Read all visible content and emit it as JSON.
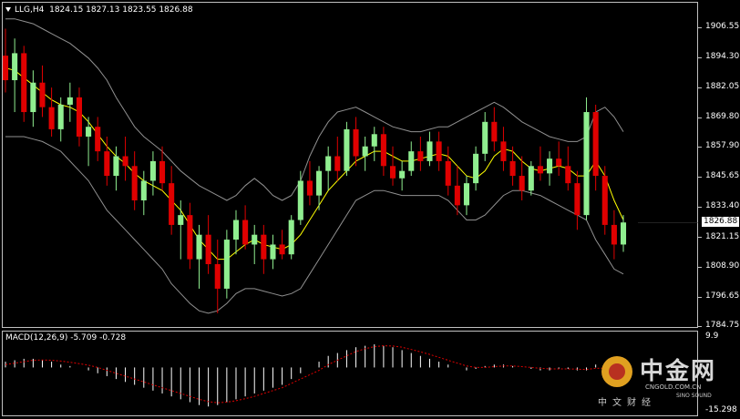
{
  "header": {
    "symbol": "LLG,H4",
    "ohlc": "1824.15 1827.13 1823.55 1826.88"
  },
  "price_axis": {
    "labels": [
      "1906.55",
      "1894.30",
      "1882.05",
      "1869.80",
      "1857.90",
      "1845.65",
      "1833.40",
      "1821.15",
      "1808.90",
      "1796.65",
      "1784.75"
    ],
    "current_price": "1826.88"
  },
  "macd": {
    "label": "MACD(12,26,9) -5.709 -0.728",
    "axis_top": "9.9",
    "axis_bottom": "-15.298"
  },
  "watermark": {
    "brand": "中金网",
    "site": "CNGOLD.COM.CN",
    "slogan": "中文财经",
    "sinosound": "SINO SOUND"
  },
  "colors": {
    "background": "#000000",
    "bull_candle": "#90ee90",
    "bear_candle": "#e00000",
    "ma_line": "#ffff00",
    "band_line": "#909090",
    "signal_line": "#e00000",
    "histogram": "#ffffff"
  },
  "chart_data": [
    {
      "type": "candlestick",
      "title": "LLG,H4",
      "ylim": [
        1784.75,
        1912
      ],
      "grid": false,
      "ohlc": [
        [
          1895,
          1906,
          1880,
          1885
        ],
        [
          1885,
          1902,
          1872,
          1896
        ],
        [
          1896,
          1899,
          1868,
          1872
        ],
        [
          1872,
          1889,
          1866,
          1884
        ],
        [
          1884,
          1891,
          1870,
          1874
        ],
        [
          1874,
          1882,
          1862,
          1865
        ],
        [
          1865,
          1878,
          1860,
          1875
        ],
        [
          1875,
          1884,
          1868,
          1878
        ],
        [
          1878,
          1882,
          1858,
          1862
        ],
        [
          1862,
          1870,
          1850,
          1866
        ],
        [
          1866,
          1870,
          1852,
          1856
        ],
        [
          1856,
          1862,
          1842,
          1846
        ],
        [
          1846,
          1858,
          1840,
          1854
        ],
        [
          1854,
          1862,
          1844,
          1850
        ],
        [
          1850,
          1856,
          1832,
          1836
        ],
        [
          1836,
          1848,
          1830,
          1844
        ],
        [
          1844,
          1856,
          1838,
          1852
        ],
        [
          1852,
          1858,
          1840,
          1843
        ],
        [
          1843,
          1850,
          1822,
          1826
        ],
        [
          1826,
          1836,
          1812,
          1830
        ],
        [
          1830,
          1835,
          1808,
          1812
        ],
        [
          1812,
          1826,
          1800,
          1822
        ],
        [
          1822,
          1830,
          1806,
          1810
        ],
        [
          1810,
          1820,
          1790,
          1800
        ],
        [
          1800,
          1824,
          1796,
          1820
        ],
        [
          1820,
          1832,
          1814,
          1828
        ],
        [
          1828,
          1834,
          1816,
          1818
        ],
        [
          1818,
          1826,
          1810,
          1822
        ],
        [
          1822,
          1826,
          1806,
          1812
        ],
        [
          1812,
          1822,
          1808,
          1818
        ],
        [
          1818,
          1824,
          1812,
          1814
        ],
        [
          1814,
          1830,
          1812,
          1828
        ],
        [
          1828,
          1848,
          1826,
          1844
        ],
        [
          1844,
          1852,
          1834,
          1838
        ],
        [
          1838,
          1850,
          1832,
          1848
        ],
        [
          1848,
          1858,
          1840,
          1854
        ],
        [
          1854,
          1862,
          1844,
          1848
        ],
        [
          1848,
          1868,
          1846,
          1865
        ],
        [
          1865,
          1870,
          1850,
          1854
        ],
        [
          1854,
          1862,
          1848,
          1858
        ],
        [
          1858,
          1866,
          1852,
          1863
        ],
        [
          1863,
          1866,
          1846,
          1850
        ],
        [
          1850,
          1858,
          1842,
          1845
        ],
        [
          1845,
          1852,
          1840,
          1848
        ],
        [
          1848,
          1860,
          1846,
          1856
        ],
        [
          1856,
          1862,
          1848,
          1852
        ],
        [
          1852,
          1864,
          1850,
          1860
        ],
        [
          1860,
          1864,
          1848,
          1852
        ],
        [
          1852,
          1858,
          1838,
          1842
        ],
        [
          1842,
          1850,
          1830,
          1834
        ],
        [
          1834,
          1846,
          1830,
          1843
        ],
        [
          1843,
          1858,
          1840,
          1855
        ],
        [
          1855,
          1872,
          1852,
          1868
        ],
        [
          1868,
          1874,
          1856,
          1860
        ],
        [
          1860,
          1866,
          1848,
          1852
        ],
        [
          1852,
          1858,
          1842,
          1846
        ],
        [
          1846,
          1854,
          1836,
          1840
        ],
        [
          1840,
          1852,
          1838,
          1850
        ],
        [
          1850,
          1858,
          1844,
          1847
        ],
        [
          1847,
          1856,
          1842,
          1853
        ],
        [
          1853,
          1860,
          1846,
          1850
        ],
        [
          1850,
          1858,
          1840,
          1843
        ],
        [
          1843,
          1848,
          1824,
          1830
        ],
        [
          1830,
          1878,
          1828,
          1872
        ],
        [
          1872,
          1875,
          1840,
          1846
        ],
        [
          1846,
          1850,
          1822,
          1826
        ],
        [
          1826,
          1832,
          1812,
          1818
        ],
        [
          1818,
          1830,
          1815,
          1827
        ]
      ],
      "overlays": [
        {
          "name": "MA",
          "color": "#ffff00",
          "values": [
            1890,
            1889,
            1886,
            1883,
            1880,
            1877,
            1875,
            1874,
            1872,
            1868,
            1863,
            1858,
            1854,
            1851,
            1847,
            1844,
            1842,
            1840,
            1836,
            1832,
            1826,
            1820,
            1816,
            1812,
            1812,
            1815,
            1818,
            1820,
            1818,
            1817,
            1816,
            1818,
            1822,
            1828,
            1834,
            1840,
            1844,
            1848,
            1852,
            1854,
            1856,
            1856,
            1854,
            1852,
            1852,
            1853,
            1854,
            1855,
            1854,
            1850,
            1846,
            1845,
            1848,
            1854,
            1857,
            1856,
            1852,
            1849,
            1848,
            1849,
            1850,
            1849,
            1846,
            1846,
            1852,
            1846,
            1836,
            1828
          ]
        },
        {
          "name": "Upper",
          "color": "#909090",
          "values": [
            1910,
            1910,
            1909,
            1908,
            1906,
            1904,
            1902,
            1900,
            1897,
            1894,
            1890,
            1885,
            1878,
            1872,
            1866,
            1862,
            1859,
            1856,
            1852,
            1848,
            1845,
            1842,
            1840,
            1838,
            1836,
            1838,
            1842,
            1845,
            1842,
            1838,
            1836,
            1838,
            1844,
            1854,
            1862,
            1868,
            1872,
            1873,
            1874,
            1872,
            1870,
            1868,
            1866,
            1865,
            1864,
            1864,
            1865,
            1866,
            1866,
            1868,
            1870,
            1872,
            1874,
            1876,
            1874,
            1871,
            1868,
            1866,
            1864,
            1862,
            1861,
            1860,
            1860,
            1862,
            1872,
            1874,
            1870,
            1864
          ]
        },
        {
          "name": "Lower",
          "color": "#909090",
          "values": [
            1862,
            1862,
            1862,
            1861,
            1860,
            1858,
            1856,
            1852,
            1848,
            1844,
            1838,
            1832,
            1828,
            1824,
            1820,
            1816,
            1812,
            1808,
            1802,
            1798,
            1794,
            1791,
            1790,
            1791,
            1794,
            1798,
            1800,
            1800,
            1799,
            1798,
            1797,
            1798,
            1800,
            1806,
            1812,
            1818,
            1824,
            1830,
            1836,
            1838,
            1840,
            1840,
            1839,
            1838,
            1838,
            1838,
            1838,
            1838,
            1836,
            1832,
            1828,
            1828,
            1830,
            1834,
            1838,
            1840,
            1840,
            1839,
            1838,
            1836,
            1834,
            1832,
            1830,
            1828,
            1820,
            1814,
            1808,
            1806
          ]
        }
      ]
    },
    {
      "type": "bar",
      "title": "MACD(12,26,9) -5.709 -0.728",
      "ylim": [
        -15.298,
        9.9
      ],
      "series": [
        {
          "name": "MACD",
          "color": "#ffffff",
          "values": [
            2,
            2.5,
            3,
            3,
            2.5,
            2,
            1,
            0.5,
            0,
            -1,
            -2,
            -3,
            -4,
            -5,
            -6,
            -7,
            -8,
            -9,
            -10,
            -11,
            -12,
            -13,
            -13.5,
            -13,
            -12,
            -11,
            -10,
            -9,
            -8,
            -7,
            -6,
            -4,
            -2,
            0,
            2,
            4,
            5,
            6,
            7,
            7.5,
            8,
            7.5,
            7,
            6,
            5,
            4,
            3,
            2,
            1,
            0,
            -1,
            -0.5,
            0.5,
            1,
            1,
            0.5,
            0,
            -0.5,
            -1,
            -1,
            -0.5,
            -0.5,
            -1,
            -1,
            1,
            0,
            -3,
            -5.709
          ]
        },
        {
          "name": "Signal",
          "color": "#e00000",
          "values": [
            1,
            1.5,
            2,
            2.5,
            2.6,
            2.5,
            2.2,
            1.8,
            1.3,
            0.8,
            0,
            -1,
            -2,
            -3,
            -4,
            -5,
            -6,
            -7,
            -8,
            -9,
            -10,
            -11,
            -11.8,
            -12.2,
            -12,
            -11.5,
            -10.8,
            -10,
            -9,
            -8,
            -7,
            -5.5,
            -4,
            -2.5,
            -1,
            1,
            2.5,
            4,
            5.5,
            6.5,
            7.2,
            7.5,
            7.4,
            7,
            6.2,
            5.4,
            4.5,
            3.5,
            2.5,
            1.5,
            0.5,
            0,
            0,
            0.3,
            0.5,
            0.5,
            0.3,
            0,
            -0.3,
            -0.5,
            -0.5,
            -0.5,
            -0.6,
            -0.7,
            -0.3,
            -0.2,
            -0.5,
            -0.728
          ]
        }
      ]
    }
  ]
}
